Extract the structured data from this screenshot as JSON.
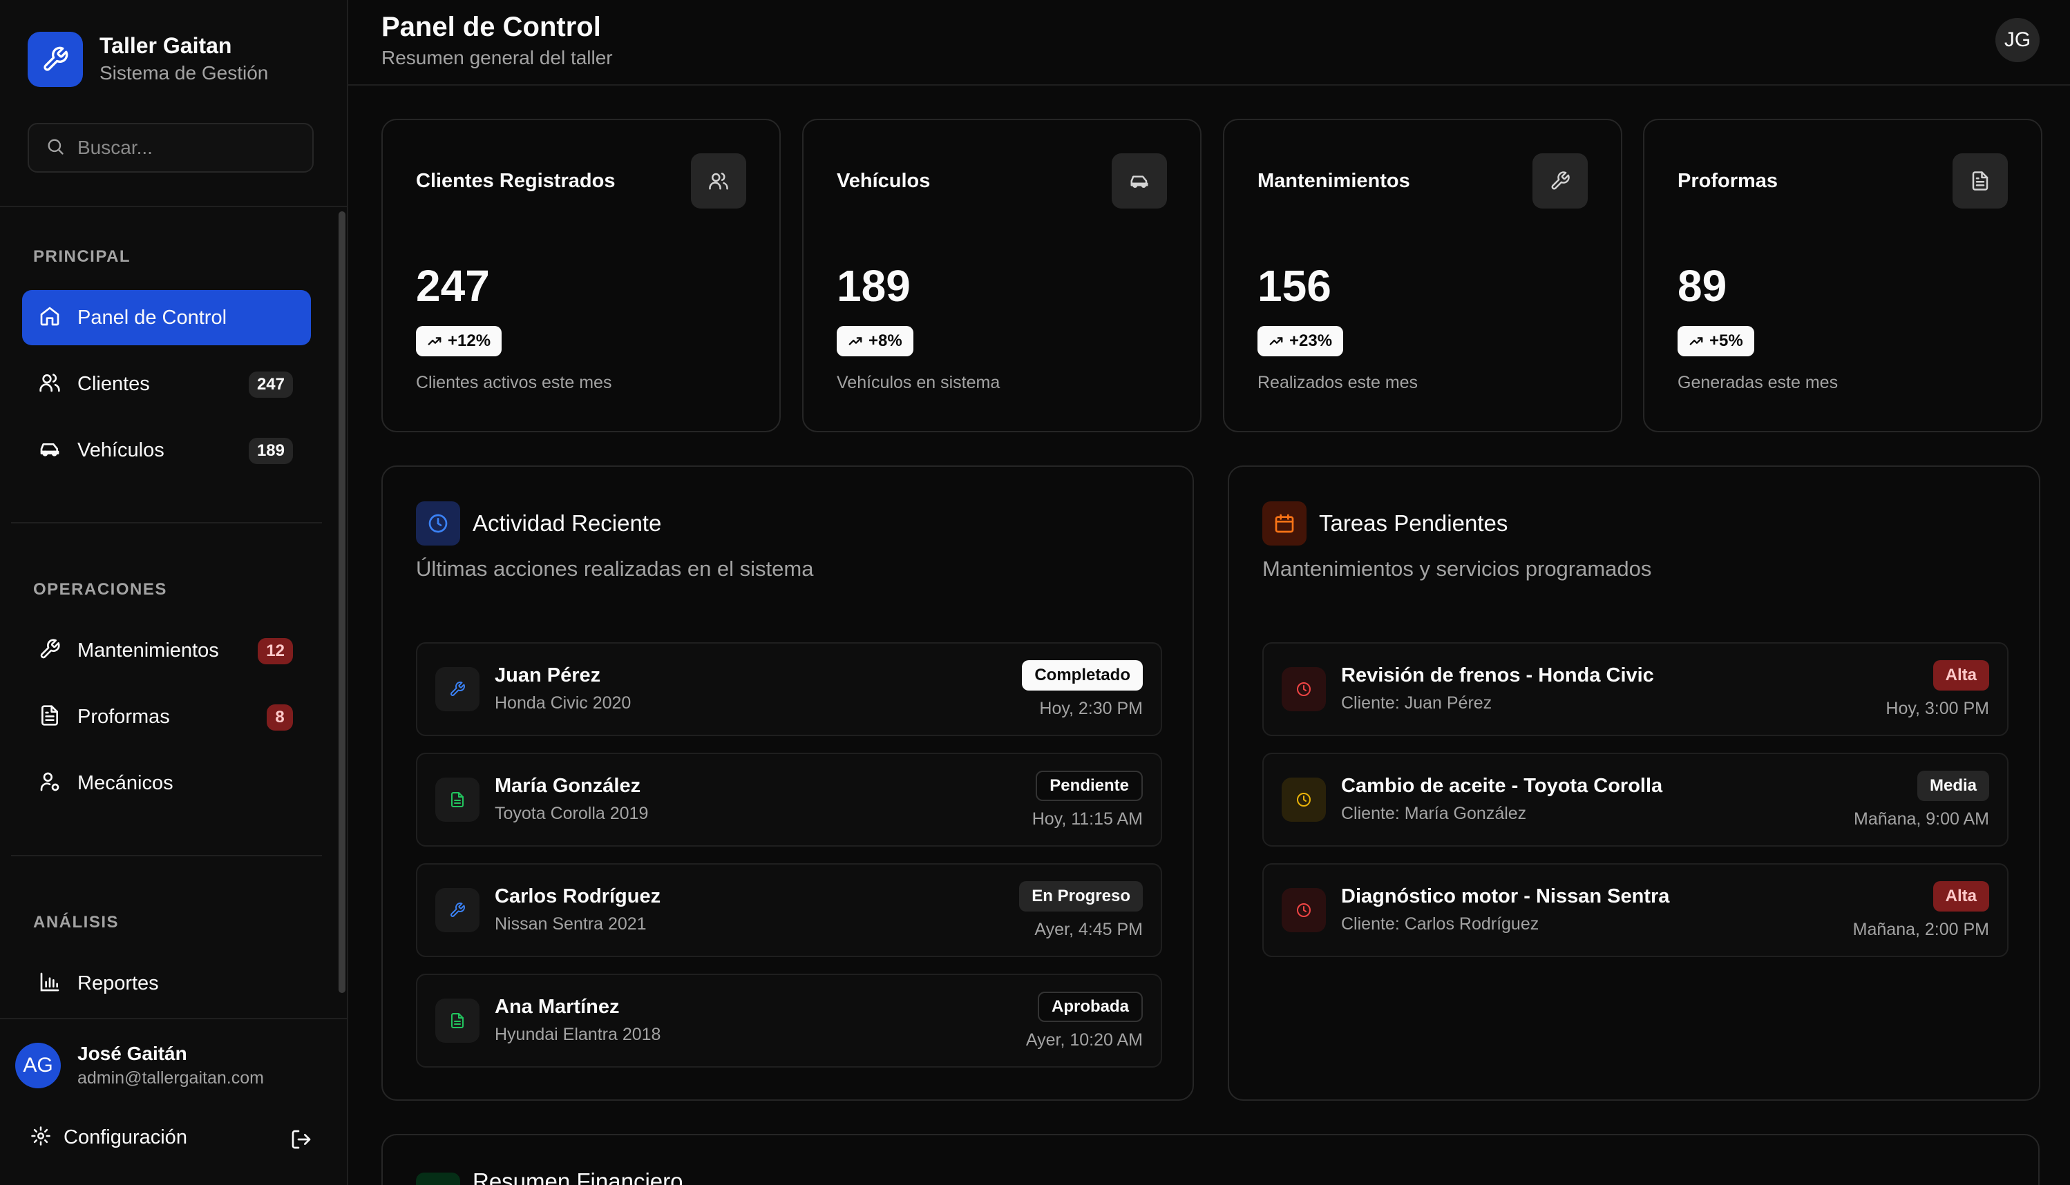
{
  "brand": {
    "title": "Taller Gaitan",
    "subtitle": "Sistema de Gestión"
  },
  "search": {
    "placeholder": "Buscar..."
  },
  "sidebar": {
    "sections": [
      {
        "label": "PRINCIPAL"
      },
      {
        "label": "OPERACIONES"
      },
      {
        "label": "ANÁLISIS"
      }
    ],
    "items": [
      {
        "label": "Panel de Control",
        "icon": "home-icon",
        "active": true
      },
      {
        "label": "Clientes",
        "icon": "users-icon",
        "badge": "247"
      },
      {
        "label": "Vehículos",
        "icon": "car-icon",
        "badge": "189"
      },
      {
        "label": "Mantenimientos",
        "icon": "wrench-icon",
        "badge": "12"
      },
      {
        "label": "Proformas",
        "icon": "file-icon",
        "badge": "8"
      },
      {
        "label": "Mecánicos",
        "icon": "user-cog-icon"
      },
      {
        "label": "Reportes",
        "icon": "bar-chart-icon"
      }
    ],
    "user": {
      "initials": "AG",
      "name": "José Gaitán",
      "email": "admin@tallergaitan.com"
    },
    "config_label": "Configuración"
  },
  "header": {
    "title": "Panel de Control",
    "subtitle": "Resumen general del taller",
    "avatar": "JG"
  },
  "stats": [
    {
      "title": "Clientes Registrados",
      "value": "247",
      "trend": "+12%",
      "desc": "Clientes activos este mes",
      "icon": "users-icon"
    },
    {
      "title": "Vehículos",
      "value": "189",
      "trend": "+8%",
      "desc": "Vehículos en sistema",
      "icon": "car-icon"
    },
    {
      "title": "Mantenimientos",
      "value": "156",
      "trend": "+23%",
      "desc": "Realizados este mes",
      "icon": "wrench-icon"
    },
    {
      "title": "Proformas",
      "value": "89",
      "trend": "+5%",
      "desc": "Generadas este mes",
      "icon": "file-icon"
    }
  ],
  "activity": {
    "title": "Actividad Reciente",
    "subtitle": "Últimas acciones realizadas en el sistema",
    "items": [
      {
        "name": "Juan Pérez",
        "vehicle": "Honda Civic 2020",
        "status": "Completado",
        "time": "Hoy, 2:30 PM",
        "icon": "wrench-icon"
      },
      {
        "name": "María González",
        "vehicle": "Toyota Corolla 2019",
        "status": "Pendiente",
        "time": "Hoy, 11:15 AM",
        "icon": "file-icon"
      },
      {
        "name": "Carlos Rodríguez",
        "vehicle": "Nissan Sentra 2021",
        "status": "En Progreso",
        "time": "Ayer, 4:45 PM",
        "icon": "wrench-icon"
      },
      {
        "name": "Ana Martínez",
        "vehicle": "Hyundai Elantra 2018",
        "status": "Aprobada",
        "time": "Ayer, 10:20 AM",
        "icon": "file-icon"
      }
    ]
  },
  "tasks": {
    "title": "Tareas Pendientes",
    "subtitle": "Mantenimientos y servicios programados",
    "items": [
      {
        "title": "Revisión de frenos - Honda Civic",
        "client": "Cliente: Juan Pérez",
        "priority": "Alta",
        "time": "Hoy, 3:00 PM"
      },
      {
        "title": "Cambio de aceite - Toyota Corolla",
        "client": "Cliente: María González",
        "priority": "Media",
        "time": "Mañana, 9:00 AM"
      },
      {
        "title": "Diagnóstico motor - Nissan Sentra",
        "client": "Cliente: Carlos Rodríguez",
        "priority": "Alta",
        "time": "Mañana, 2:00 PM"
      }
    ]
  },
  "finance": {
    "title": "Resumen Financiero"
  },
  "colors": {
    "accent": "#1d4ed8",
    "badge_red": "#7f1d1d",
    "task_orange": "#f97316",
    "task_yellow": "#eab308",
    "task_red": "#ef4444",
    "file_green": "#22c55e"
  }
}
